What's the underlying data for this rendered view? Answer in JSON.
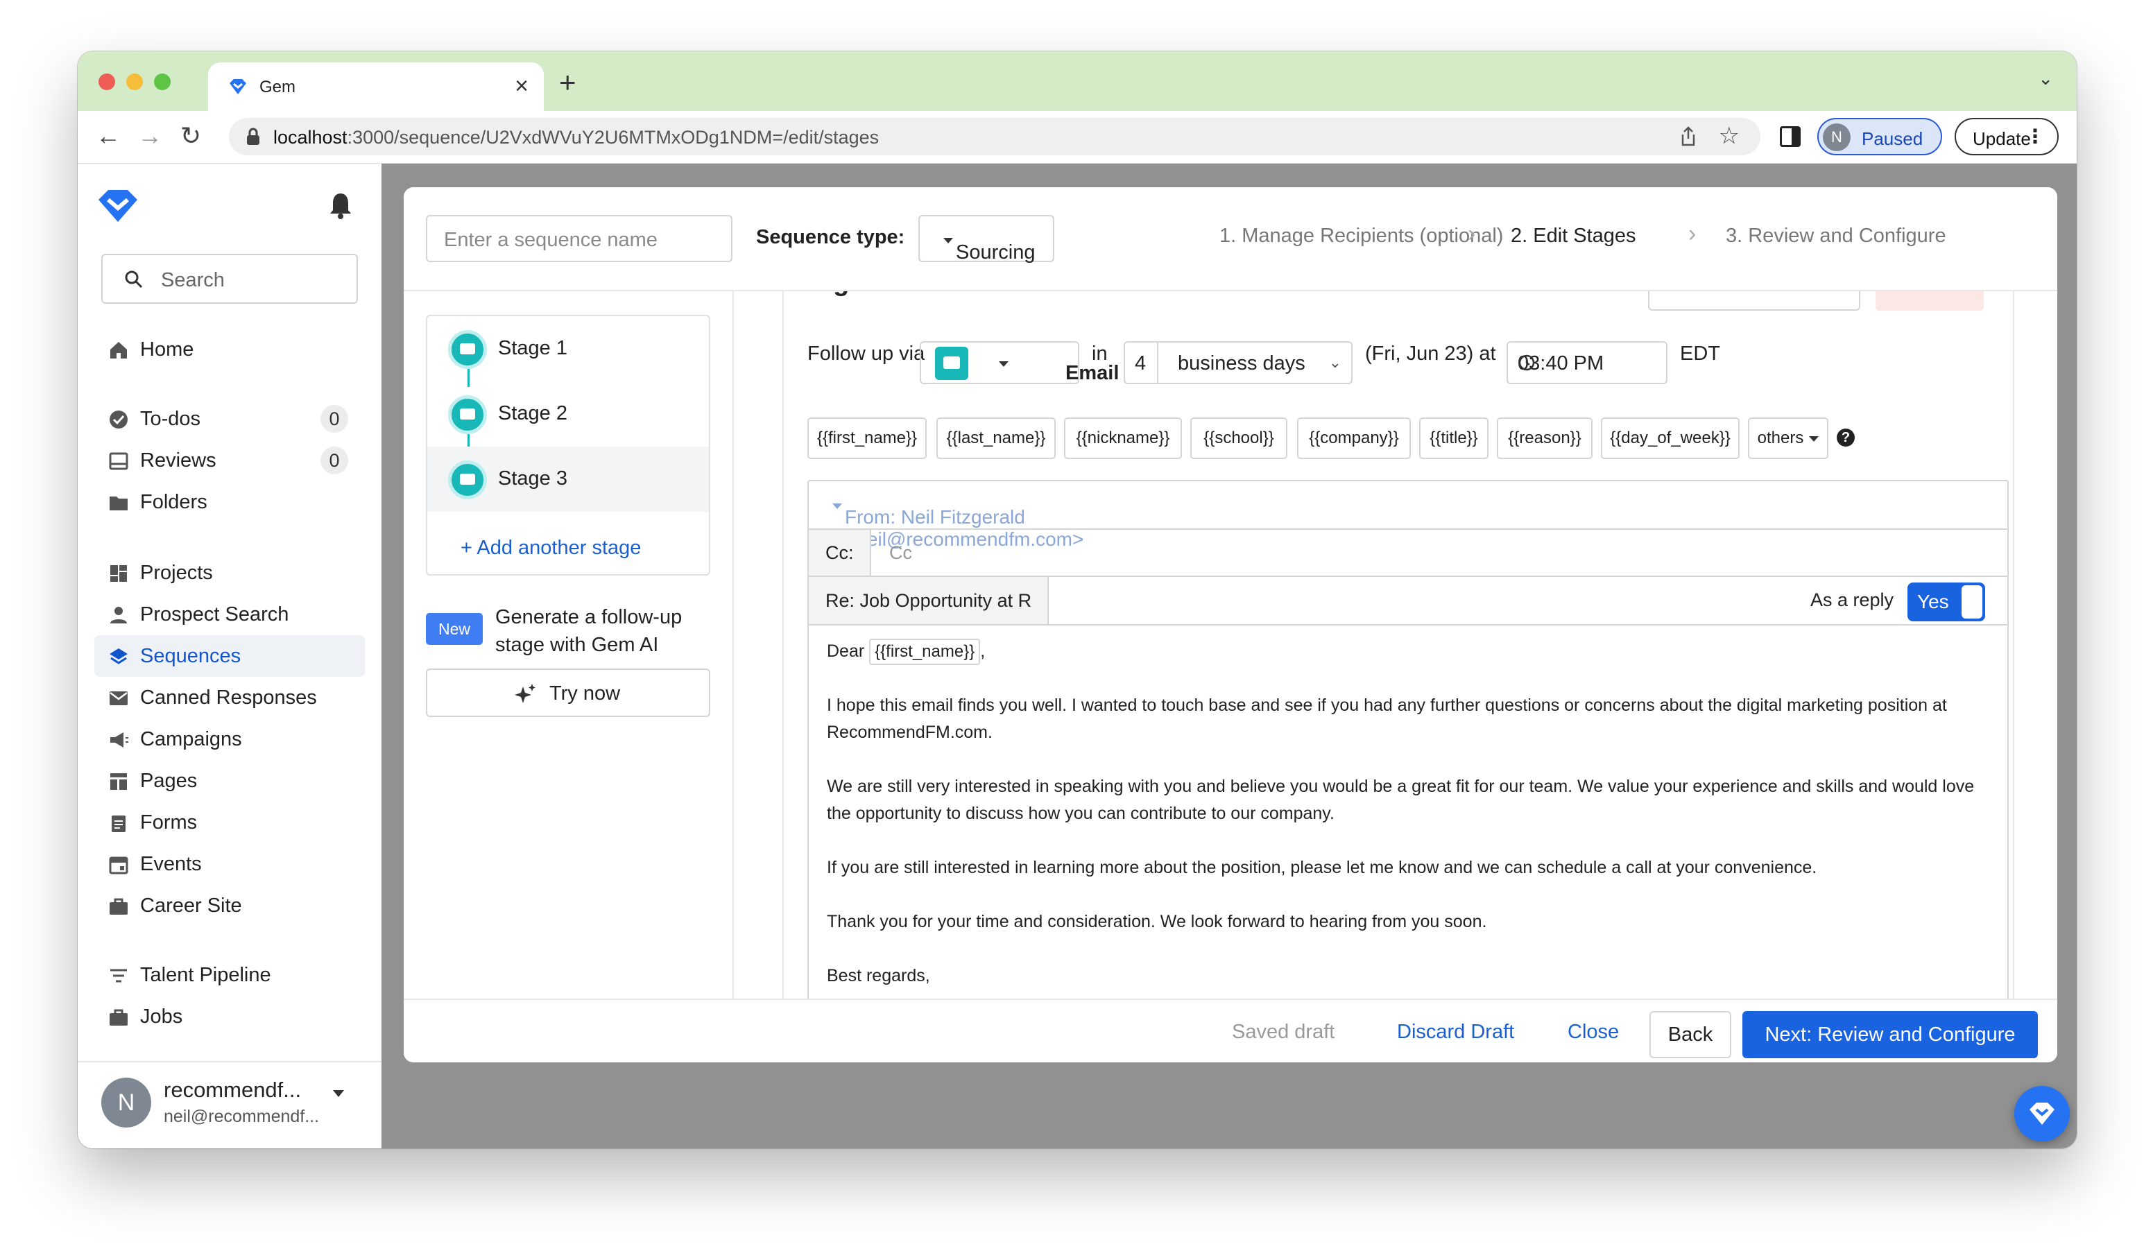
{
  "browser": {
    "tab_title": "Gem",
    "url_host": "localhost",
    "url_path": ":3000/sequence/U2VxdWVuY2U6MTMxODg1NDM=/edit/stages",
    "profile_initial": "N",
    "paused_label": "Paused",
    "update_label": "Update"
  },
  "sidebar": {
    "search_placeholder": "Search",
    "items": [
      {
        "label": "Home"
      },
      {
        "label": "To-dos",
        "count": "0"
      },
      {
        "label": "Reviews",
        "count": "0"
      },
      {
        "label": "Folders"
      },
      {
        "label": "Projects"
      },
      {
        "label": "Prospect Search"
      },
      {
        "label": "Sequences"
      },
      {
        "label": "Canned Responses"
      },
      {
        "label": "Campaigns"
      },
      {
        "label": "Pages"
      },
      {
        "label": "Forms"
      },
      {
        "label": "Events"
      },
      {
        "label": "Career Site"
      },
      {
        "label": "Talent Pipeline"
      },
      {
        "label": "Jobs"
      }
    ],
    "user": {
      "initial": "N",
      "name": "recommendf...",
      "email": "neil@recommendf..."
    }
  },
  "header": {
    "name_placeholder": "Enter a sequence name",
    "type_label": "Sequence type:",
    "type_value": "Sourcing",
    "steps": [
      "1. Manage Recipients (optional)",
      "2. Edit Stages",
      "3. Review and Configure"
    ]
  },
  "stages": {
    "items": [
      "Stage 1",
      "Stage 2",
      "Stage 3"
    ],
    "add_label": "+ Add another stage",
    "new_badge": "New",
    "gen_text": "Generate a follow-up stage with Gem AI",
    "try_label": "Try now"
  },
  "editor": {
    "follow_label": "Follow up via",
    "channel": "Email",
    "in_label": "in",
    "days_value": "4",
    "days_unit": "business days",
    "date_text": "(Fri, Jun 23) at",
    "time_value": "03:40 PM",
    "tz": "EDT",
    "tokens": [
      "{{first_name}}",
      "{{last_name}}",
      "{{nickname}}",
      "{{school}}",
      "{{company}}",
      "{{title}}",
      "{{reason}}",
      "{{day_of_week}}",
      "others"
    ],
    "help": "?",
    "from": "From: Neil Fitzgerald <neil@recommendfm.com>",
    "cc_label": "Cc:",
    "cc_placeholder": "Cc",
    "subject": "Re: Job Opportunity at R",
    "as_reply_label": "As a reply",
    "toggle_label": "Yes",
    "greeting": "Dear",
    "greeting_token": "{{first_name}}",
    "greeting_end": ",",
    "paragraphs": [
      "I hope this email finds you well. I wanted to touch base and see if you had any further questions or concerns about the digital marketing position at RecommendFM.com.",
      "We are still very interested in speaking with you and believe you would be a great fit for our team. We value your experience and skills and would love the opportunity to discuss how you can contribute to our company.",
      "If you are still interested in learning more about the position, please let me know and we can schedule a call at your convenience.",
      "Thank you for your time and consideration. We look forward to hearing from you soon.",
      "Best regards,"
    ]
  },
  "footer": {
    "saved": "Saved draft",
    "discard": "Discard Draft",
    "close": "Close",
    "back": "Back",
    "next": "Next: Review and Configure"
  },
  "colors": {
    "accent": "#1a63e0",
    "teal": "#19b8b8",
    "tabbar": "#d3ebc6"
  }
}
